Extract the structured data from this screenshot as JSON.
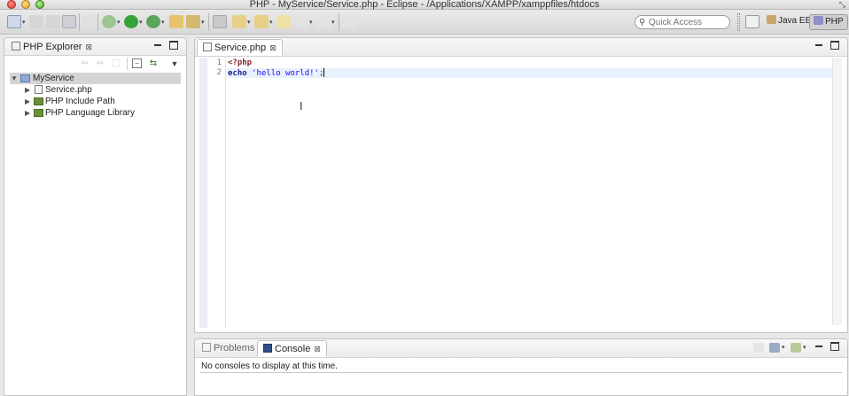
{
  "window": {
    "title": "PHP - MyService/Service.php - Eclipse - /Applications/XAMPP/xamppfiles/htdocs"
  },
  "toolbar": {
    "quick_access_placeholder": "Quick Access",
    "perspectives": [
      {
        "label": "Java EE",
        "icon": "java-ee-perspective-icon",
        "active": false
      },
      {
        "label": "PHP",
        "icon": "php-perspective-icon",
        "active": true
      }
    ]
  },
  "explorer": {
    "tab_label": "PHP Explorer",
    "tree": [
      {
        "label": "MyService",
        "icon": "php-project-icon",
        "expanded": true,
        "selected": true,
        "level": 0
      },
      {
        "label": "Service.php",
        "icon": "php-file-icon",
        "expanded": false,
        "level": 1
      },
      {
        "label": "PHP Include Path",
        "icon": "library-icon",
        "expanded": false,
        "level": 1
      },
      {
        "label": "PHP Language Library",
        "icon": "library-icon",
        "expanded": false,
        "level": 1
      }
    ]
  },
  "editor": {
    "tab_label": "Service.php",
    "line_numbers": [
      "1",
      "2"
    ],
    "lines": {
      "l1_tag": "<?php",
      "l2_keyword": "echo",
      "l2_string": " 'hello world!'",
      "l2_end": ";"
    }
  },
  "console_panel": {
    "tabs": [
      {
        "label": "Problems",
        "active": false
      },
      {
        "label": "Console",
        "active": true
      }
    ],
    "message": "No consoles to display at this time."
  },
  "colors": {
    "php_tag": "#8b1f2c",
    "keyword": "#1a1a8c",
    "string": "#2a00ff",
    "current_line": "#e8f2fe"
  }
}
